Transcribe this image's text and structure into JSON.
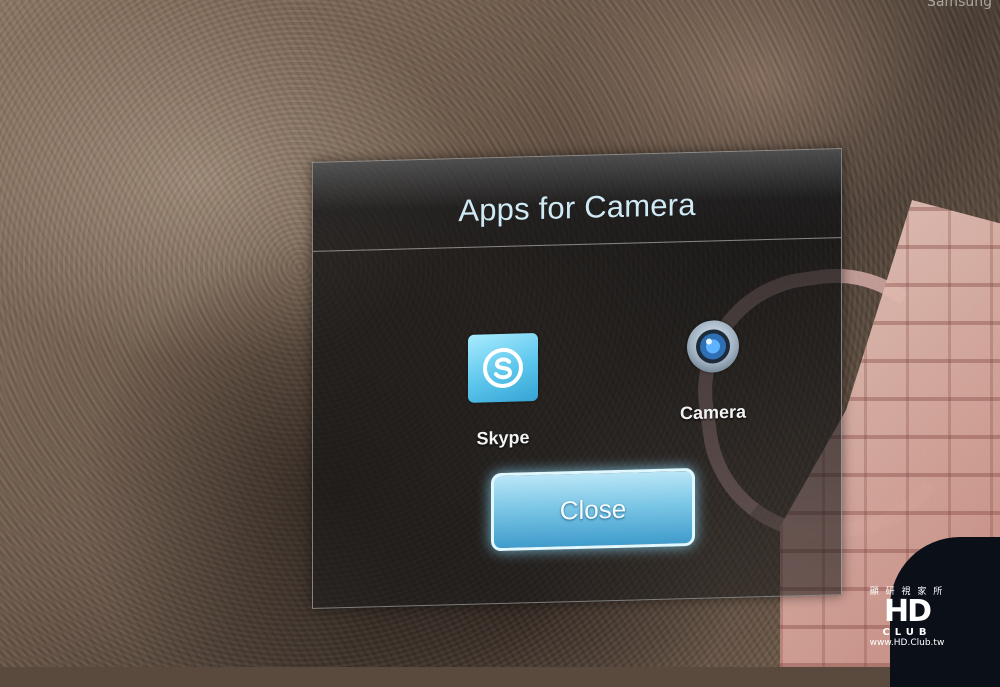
{
  "brand": "Samsung",
  "dialog": {
    "title": "Apps for Camera",
    "apps": [
      {
        "label": "Skype",
        "icon": "skype-icon",
        "color": "#5cc6ec"
      },
      {
        "label": "Camera",
        "icon": "camera-lens-icon",
        "color": "#4a90c8"
      }
    ],
    "close_label": "Close",
    "accent": "#7cc7e6"
  },
  "watermark": {
    "top": "顯 研 視 家 所",
    "logo": "HD",
    "sub": "CLUB",
    "url": "www.HD.Club.tw"
  }
}
